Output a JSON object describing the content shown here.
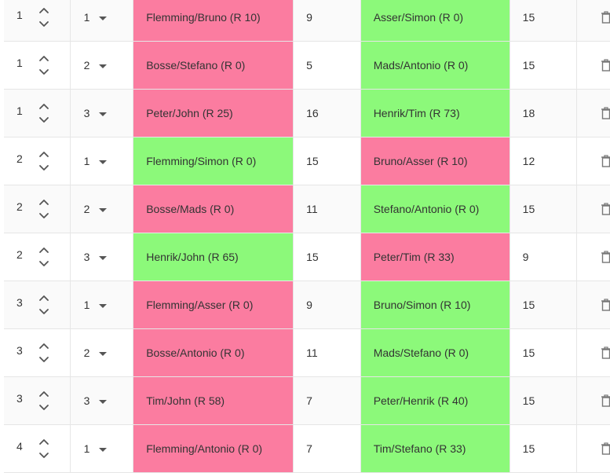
{
  "rows": [
    {
      "round": "1",
      "court": "1",
      "team1": "Flemming/Bruno (R 10)",
      "score1": "9",
      "team1_status": "lose",
      "team2": "Asser/Simon (R 0)",
      "score2": "15",
      "team2_status": "win"
    },
    {
      "round": "1",
      "court": "2",
      "team1": "Bosse/Stefano (R 0)",
      "score1": "5",
      "team1_status": "lose",
      "team2": "Mads/Antonio (R 0)",
      "score2": "15",
      "team2_status": "win"
    },
    {
      "round": "1",
      "court": "3",
      "team1": "Peter/John (R 25)",
      "score1": "16",
      "team1_status": "lose",
      "team2": "Henrik/Tim (R 73)",
      "score2": "18",
      "team2_status": "win"
    },
    {
      "round": "2",
      "court": "1",
      "team1": "Flemming/Simon (R 0)",
      "score1": "15",
      "team1_status": "win",
      "team2": "Bruno/Asser (R 10)",
      "score2": "12",
      "team2_status": "lose"
    },
    {
      "round": "2",
      "court": "2",
      "team1": "Bosse/Mads (R 0)",
      "score1": "11",
      "team1_status": "lose",
      "team2": "Stefano/Antonio (R 0)",
      "score2": "15",
      "team2_status": "win"
    },
    {
      "round": "2",
      "court": "3",
      "team1": "Henrik/John (R 65)",
      "score1": "15",
      "team1_status": "win",
      "team2": "Peter/Tim (R 33)",
      "score2": "9",
      "team2_status": "lose"
    },
    {
      "round": "3",
      "court": "1",
      "team1": "Flemming/Asser (R 0)",
      "score1": "9",
      "team1_status": "lose",
      "team2": "Bruno/Simon (R 10)",
      "score2": "15",
      "team2_status": "win"
    },
    {
      "round": "3",
      "court": "2",
      "team1": "Bosse/Antonio (R 0)",
      "score1": "11",
      "team1_status": "lose",
      "team2": "Mads/Stefano (R 0)",
      "score2": "15",
      "team2_status": "win"
    },
    {
      "round": "3",
      "court": "3",
      "team1": "Tim/John (R 58)",
      "score1": "7",
      "team1_status": "lose",
      "team2": "Peter/Henrik (R 40)",
      "score2": "15",
      "team2_status": "win"
    },
    {
      "round": "4",
      "court": "1",
      "team1": "Flemming/Antonio (R 0)",
      "score1": "7",
      "team1_status": "lose",
      "team2": "Tim/Stefano (R 33)",
      "score2": "15",
      "team2_status": "win"
    }
  ],
  "colors": {
    "win": "#8cf97a",
    "lose": "#fb7ca0",
    "row_alt": "#fafafa",
    "border": "#e6e6e6"
  },
  "icons": {
    "round_stepper": "chevron-up-down-icon",
    "court_select": "caret-down-icon",
    "row_action": "trash-icon"
  }
}
